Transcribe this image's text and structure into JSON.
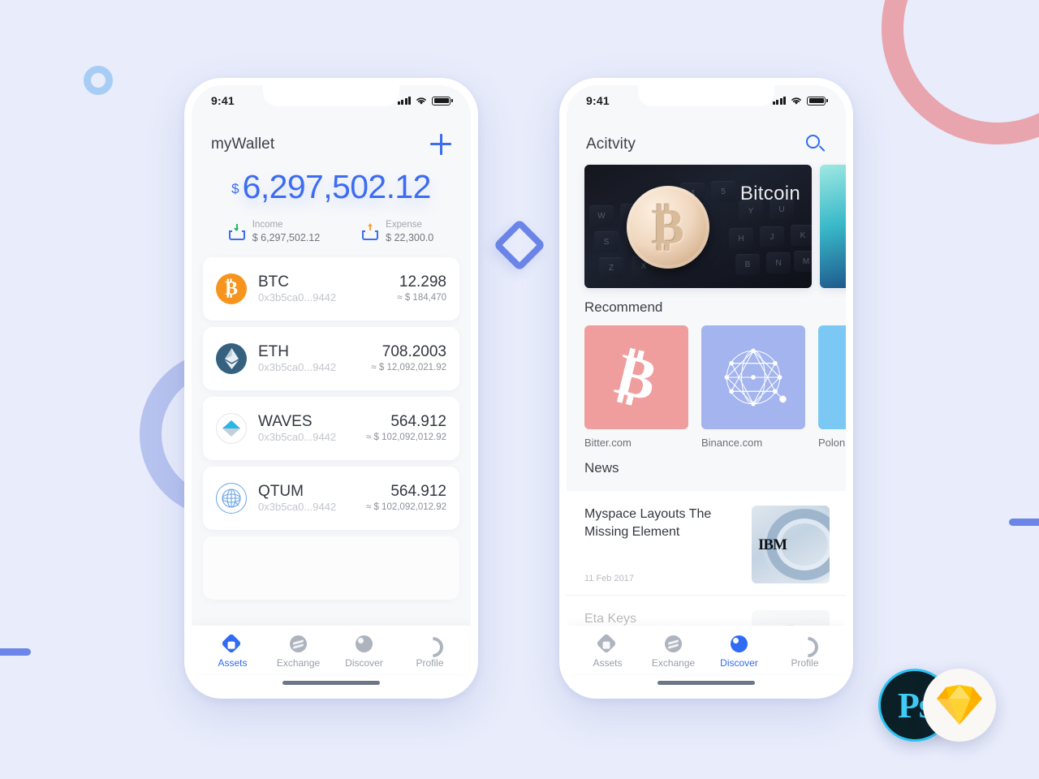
{
  "decorations": {
    "colors": {
      "background": "#e8ecfb",
      "ring_small": "#a8cdf5",
      "arc_pink": "#e8a5ad",
      "arc_purple": "#b7c3ef",
      "bar": "#6b85e8",
      "diamond": "#6b85e8"
    }
  },
  "logos": {
    "photoshop_label": "Ps",
    "sketch_label": "sketch-diamond"
  },
  "phone_assets": {
    "status": {
      "time": "9:41"
    },
    "header": {
      "title": "myWallet",
      "add_label": "+"
    },
    "balance": {
      "currency": "$",
      "amount": "6,297,502.12",
      "income_label": "Income",
      "income_value": "$ 6,297,502.12",
      "expense_label": "Expense",
      "expense_value": "$ 22,300.0"
    },
    "assets": [
      {
        "symbol": "BTC",
        "address": "0x3b5ca0...9442",
        "qty": "12.298",
        "fiat": "≈ $ 184,470"
      },
      {
        "symbol": "ETH",
        "address": "0x3b5ca0...9442",
        "qty": "708.2003",
        "fiat": "≈ $ 12,092,021.92"
      },
      {
        "symbol": "WAVES",
        "address": "0x3b5ca0...9442",
        "qty": "564.912",
        "fiat": "≈ $ 102,092,012.92"
      },
      {
        "symbol": "QTUM",
        "address": "0x3b5ca0...9442",
        "qty": "564.912",
        "fiat": "≈ $ 102,092,012.92"
      }
    ],
    "tabs": [
      {
        "label": "Assets",
        "active": true
      },
      {
        "label": "Exchange",
        "active": false
      },
      {
        "label": "Discover",
        "active": false
      },
      {
        "label": "Profile",
        "active": false
      }
    ]
  },
  "phone_discover": {
    "status": {
      "time": "9:41"
    },
    "header": {
      "title": "Acitvity"
    },
    "banners": [
      {
        "label": "Bitcoin",
        "style": "bitcoin-keyboard"
      },
      {
        "label": "",
        "style": "teal"
      }
    ],
    "recommend": {
      "title": "Recommend",
      "items": [
        {
          "name": "Bitter.com",
          "color": "#f09d9d",
          "logo": "bitcoin-b"
        },
        {
          "name": "Binance.com",
          "color": "#a3b4ef",
          "logo": "network-sphere"
        },
        {
          "name": "Polonie",
          "color": "#7cc8f5",
          "logo": "poloniex"
        }
      ]
    },
    "news": {
      "title": "News",
      "items": [
        {
          "title": "Myspace Layouts The Missing Element",
          "date": "11 Feb 2017",
          "thumb": "ibm"
        },
        {
          "title": "Eta Keys",
          "date": "",
          "thumb": "person"
        }
      ]
    },
    "tabs": [
      {
        "label": "Assets",
        "active": false
      },
      {
        "label": "Exchange",
        "active": false
      },
      {
        "label": "Discover",
        "active": true
      },
      {
        "label": "Profile",
        "active": false
      }
    ]
  }
}
